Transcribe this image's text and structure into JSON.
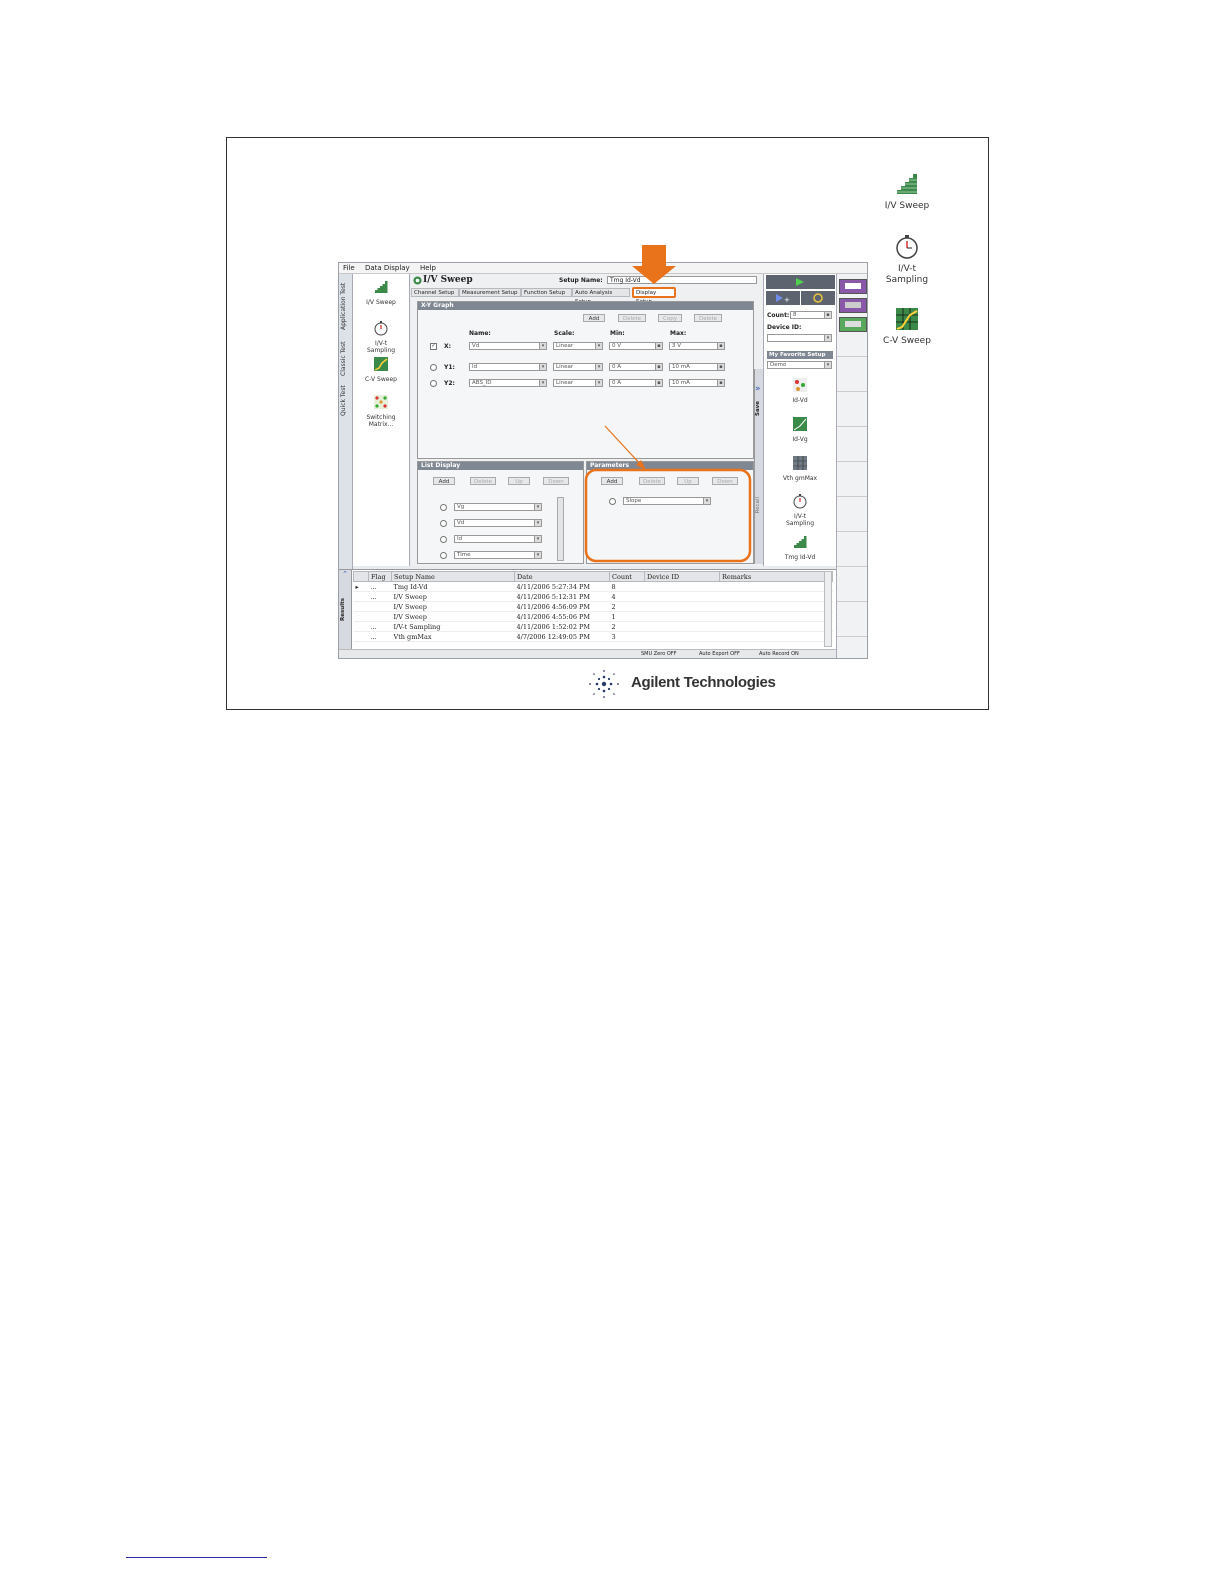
{
  "colors": {
    "accent": "#e8731a",
    "panel_head": "#7f8793",
    "icon_green": "#3c8a4a"
  },
  "menu": [
    "File",
    "Data Display",
    "Help"
  ],
  "vertical_tabs": [
    "Application Test",
    "Classic Test",
    "Quick Test"
  ],
  "apps": [
    {
      "label": "I/V Sweep",
      "icon": "iv-sweep-icon"
    },
    {
      "label": "I/V-t Sampling",
      "icon": "stopwatch-icon"
    },
    {
      "label": "C-V Sweep",
      "icon": "cv-sweep-icon"
    },
    {
      "label": "Switching Matrix...",
      "icon": "switching-matrix-icon"
    }
  ],
  "main": {
    "title": "I/V Sweep",
    "setup_name_label": "Setup Name:",
    "setup_name_value": "Tmg Id-Vd",
    "tabs": [
      "Channel Setup",
      "Measurement Setup",
      "Function Setup",
      "Auto Analysis Setup",
      "Display Setup"
    ]
  },
  "xy_graph": {
    "title": "X-Y Graph",
    "buttons": [
      "Add",
      "Delete",
      "Copy",
      "Delete"
    ],
    "headers": {
      "name": "Name:",
      "scale": "Scale:",
      "min": "Min:",
      "max": "Max:"
    },
    "rows": [
      {
        "axis": "X:",
        "name": "Vd",
        "scale": "Linear",
        "min": "0 V",
        "max": "3 V"
      },
      {
        "axis": "Y1:",
        "name": "Id",
        "scale": "Linear",
        "min": "0 A",
        "max": "10 mA"
      },
      {
        "axis": "Y2:",
        "name": "ABS_ID",
        "scale": "Linear",
        "min": "0 A",
        "max": "10 mA"
      }
    ]
  },
  "list_display": {
    "title": "List Display",
    "buttons": [
      "Add",
      "Delete",
      "Up",
      "Down"
    ],
    "items": [
      "Vg",
      "Vd",
      "Id",
      "Time"
    ]
  },
  "parameters": {
    "title": "Parameters",
    "buttons": [
      "Add",
      "Delete",
      "Up",
      "Down"
    ],
    "items": [
      "Slope"
    ]
  },
  "side": {
    "save": "Save",
    "recall": "Recall",
    "count_label": "Count:",
    "count_value": "8",
    "device_label": "Device ID:",
    "favorite_label": "My Favorite Setup",
    "favorite_value": "Demo",
    "favorites": [
      "Id-Vd",
      "Id-Vg",
      "Vth gmMax",
      "I/V-t Sampling",
      "Tmg Id-Vd"
    ]
  },
  "results": {
    "tab": "Results",
    "columns": [
      "Flag",
      "Setup Name",
      "Date",
      "Count",
      "Device ID",
      "Remarks"
    ],
    "rows": [
      {
        "flag": "...",
        "setup": "Tmg Id-Vd",
        "date": "4/11/2006 5:27:34 PM",
        "count": "8"
      },
      {
        "flag": "...",
        "setup": "I/V Sweep",
        "date": "4/11/2006 5:12:31 PM",
        "count": "4"
      },
      {
        "flag": "",
        "setup": "I/V Sweep",
        "date": "4/11/2006 4:56:09 PM",
        "count": "2"
      },
      {
        "flag": "",
        "setup": "I/V Sweep",
        "date": "4/11/2006 4:55:06 PM",
        "count": "1"
      },
      {
        "flag": "...",
        "setup": "I/V-t Sampling",
        "date": "4/11/2006 1:52:02 PM",
        "count": "2"
      },
      {
        "flag": "...",
        "setup": "Vth gmMax",
        "date": "4/7/2006 12:49:05 PM",
        "count": "3"
      }
    ]
  },
  "status_bar": [
    "SMU Zero OFF",
    "Auto Export OFF",
    "Auto Record ON"
  ],
  "desktop_icons": [
    {
      "label": "I/V Sweep",
      "icon": "iv-sweep-icon"
    },
    {
      "label": "I/V-t Sampling",
      "icon": "stopwatch-icon"
    },
    {
      "label": "C-V Sweep",
      "icon": "cv-sweep-icon"
    }
  ],
  "logo": {
    "text": "Agilent Technologies"
  }
}
